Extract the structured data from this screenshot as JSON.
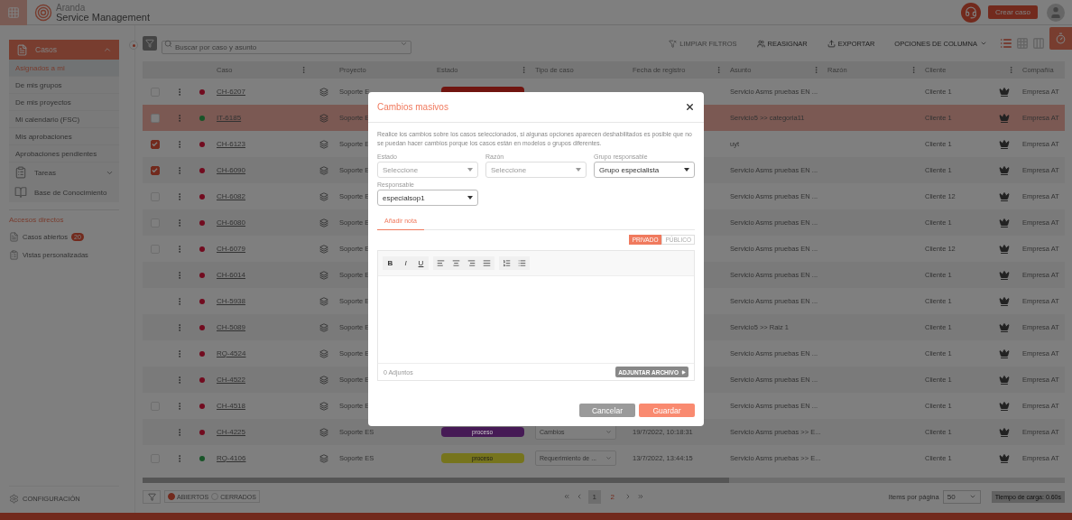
{
  "header": {
    "brand_top": "Aranda",
    "brand_name": "Service Management",
    "create_button": "Crear caso"
  },
  "sidebar": {
    "section": {
      "label": "Casos",
      "expanded": true
    },
    "items": [
      {
        "label": "Asignados a mi",
        "selected": true
      },
      {
        "label": "De mis grupos",
        "selected": false
      },
      {
        "label": "De mis proyectos",
        "selected": false
      },
      {
        "label": "Mi calendario (FSC)",
        "selected": false
      },
      {
        "label": "Mis aprobaciones",
        "selected": false
      },
      {
        "label": "Aprobaciones pendientes",
        "selected": false
      }
    ],
    "groups": [
      {
        "label": "Tareas",
        "kind": "tasks",
        "expanded": false
      },
      {
        "label": "Base de Conocimiento",
        "kind": "knowledge"
      }
    ],
    "shortcuts_title": "Accesos directos",
    "shortcuts": [
      {
        "label": "Casos abiertos",
        "badge": "20",
        "kind": "cases"
      },
      {
        "label": "Vistas personalizadas",
        "kind": "views"
      }
    ],
    "settings": "CONFIGURACIÓN"
  },
  "toolbar": {
    "search": {
      "placeholder": "Buscar por caso y asunto"
    },
    "actions": [
      {
        "label": "LIMPIAR FILTROS",
        "kind": "clear",
        "disabled": true
      },
      {
        "label": "REASIGNAR",
        "kind": "reassign",
        "disabled": false
      },
      {
        "label": "EXPORTAR",
        "kind": "export",
        "disabled": false
      }
    ],
    "column_options": "OPCIONES DE COLUMNA",
    "views": [
      {
        "kind": "list",
        "selected": true
      },
      {
        "kind": "grid",
        "selected": false
      },
      {
        "kind": "columns",
        "selected": false
      }
    ]
  },
  "table": {
    "columns": [
      {
        "label": "Caso",
        "menu": true
      },
      {
        "label": "Proyecto",
        "menu": false
      },
      {
        "label": "Estado",
        "menu": true
      },
      {
        "label": "Tipo de caso",
        "menu": false
      },
      {
        "label": "Fecha de registro",
        "menu": true
      },
      {
        "label": "Asunto",
        "menu": true
      },
      {
        "label": "Razón",
        "menu": true
      },
      {
        "label": "Cliente",
        "menu": true
      },
      {
        "label": "Compañía",
        "menu": false
      }
    ],
    "rows": [
      {
        "checked": false,
        "highlighted": false,
        "color": "#720b1f",
        "case": "CH-6207",
        "project": "Soporte E",
        "status": {
          "color": "#701510"
        },
        "subject": "Servicio Asms pruebas EN ...",
        "client": "Cliente 1",
        "company": "Empresa AT"
      },
      {
        "checked": false,
        "highlighted": true,
        "color": "#185428",
        "case": "IT-6185",
        "project": "Soporte E",
        "subject": "Servicio5 >> categoria11",
        "client": "Cliente 1",
        "company": "Empresa AT"
      },
      {
        "checked": true,
        "highlighted": false,
        "color": "#720b1f",
        "case": "CH-6123",
        "project": "Soporte E",
        "subject": "uyt",
        "client": "Cliente 1",
        "company": "Empresa AT"
      },
      {
        "checked": true,
        "highlighted": false,
        "color": "#720b1f",
        "case": "CH-6090",
        "project": "Soporte E",
        "subject": "Servicio Asms pruebas EN ...",
        "client": "Cliente 1",
        "company": "Empresa AT"
      },
      {
        "checked": false,
        "highlighted": false,
        "color": "#720b1f",
        "case": "CH-6082",
        "project": "Soporte E",
        "subject": "Servicio Asms pruebas EN ...",
        "client": "Cliente 12",
        "company": "Empresa AT"
      },
      {
        "checked": false,
        "highlighted": false,
        "color": "#720b1f",
        "case": "CH-6080",
        "project": "Soporte E",
        "subject": "Servicio Asms pruebas EN ...",
        "client": "Cliente 1",
        "company": "Empresa AT"
      },
      {
        "checked": false,
        "highlighted": false,
        "color": "#720b1f",
        "case": "CH-6079",
        "project": "Soporte E",
        "subject": "Servicio Asms pruebas EN ...",
        "client": "Cliente 12",
        "company": "Empresa AT"
      },
      {
        "highlighted": false,
        "color": "#720b1f",
        "case": "CH-6014",
        "project": "Soporte E",
        "subject": "Servicio Asms pruebas EN ...",
        "client": "Cliente 1",
        "company": "Empresa AT"
      },
      {
        "highlighted": false,
        "color": "#720b1f",
        "case": "CH-5938",
        "project": "Soporte E",
        "subject": "Servicio Asms pruebas EN ...",
        "client": "Cliente 1",
        "company": "Empresa AT"
      },
      {
        "highlighted": false,
        "color": "#720b1f",
        "case": "CH-5089",
        "project": "Soporte E",
        "subject": "Servicio5 >> Raiz 1",
        "client": "Cliente 1",
        "company": "Empresa AT"
      },
      {
        "highlighted": false,
        "color": "#720b1f",
        "case": "RQ-4524",
        "project": "Soporte E",
        "subject": "Servicio Asms pruebas EN ...",
        "client": "Cliente 1",
        "company": "Empresa AT"
      },
      {
        "highlighted": false,
        "color": "#720b1f",
        "case": "CH-4522",
        "project": "Soporte E",
        "subject": "Servicio Asms pruebas EN ...",
        "client": "Cliente 1",
        "company": "Empresa AT"
      },
      {
        "checked": false,
        "highlighted": false,
        "color": "#720b1f",
        "case": "CH-4518",
        "project": "Soporte E",
        "subject": "Servicio Asms pruebas EN ...",
        "client": "Cliente 1",
        "company": "Empresa AT"
      },
      {
        "highlighted": false,
        "color": "#720b1f",
        "case": "CH-4225",
        "project": "Soporte ES",
        "status": {
          "label": "proceso",
          "color": "#461a55"
        },
        "type": "Cambios",
        "date": "19/7/2022, 10:18:31",
        "subject": "Servicio Asms pruebas >> E...",
        "client": "Cliente 1",
        "company": "Empresa AT"
      },
      {
        "checked": false,
        "highlighted": false,
        "color": "#185428",
        "case": "RQ-4106",
        "project": "Soporte ES",
        "status": {
          "label": "proceso",
          "color": "#76741d"
        },
        "type": "Requerimiento de ...",
        "date": "13/7/2022, 13:44:15",
        "subject": "Servicio Asms pruebas >> E...",
        "client": "Cliente 1",
        "company": "Empresa AT"
      }
    ]
  },
  "footer": {
    "toggles": [
      {
        "label": "ABIERTOS",
        "on": true
      },
      {
        "label": "CERRADOS",
        "on": false
      }
    ],
    "pages": [
      {
        "label": "1",
        "selected": true
      },
      {
        "label": "2",
        "selected": false
      }
    ],
    "per_page_label": "Items por página",
    "per_page": "50",
    "load_time": "Tiempo de carga: 0.60s"
  },
  "modal": {
    "title": "Cambios masivos",
    "description": "Realice los cambios sobre los casos seleccionados, si algunas opciones aparecen deshabilitados es posible que no se puedan hacer cambios porque los casos están en modelos o grupos diferentes.",
    "fields": [
      {
        "label": "Estado",
        "placeholder": "Seleccione"
      },
      {
        "label": "Razón",
        "placeholder": "Seleccione"
      },
      {
        "label": "Grupo responsable",
        "value": "Grupo especialista"
      },
      {
        "label": "Responsable",
        "value": "especialsop1"
      }
    ],
    "tabs": [
      {
        "label": "Añadir nota",
        "selected": true
      }
    ],
    "visibility": [
      {
        "label": "PRIVADO",
        "selected": true
      },
      {
        "label": "PÚBLICO",
        "selected": false
      }
    ],
    "editor_tools": [
      {
        "kind": "bold",
        "label": "B"
      },
      {
        "kind": "italic",
        "label": "I"
      },
      {
        "kind": "underline",
        "label": "U"
      },
      {
        "kind": "align-left"
      },
      {
        "kind": "align-center"
      },
      {
        "kind": "align-right"
      },
      {
        "kind": "justify"
      },
      {
        "kind": "ordered-list"
      },
      {
        "kind": "bullet-list"
      }
    ],
    "attachments": "0 Adjuntos",
    "attach_button": "ADJUNTAR ARCHIVO",
    "buttons": [
      {
        "label": "Cancelar",
        "kind": "secondary"
      },
      {
        "label": "Guardar",
        "kind": "primary"
      }
    ]
  }
}
